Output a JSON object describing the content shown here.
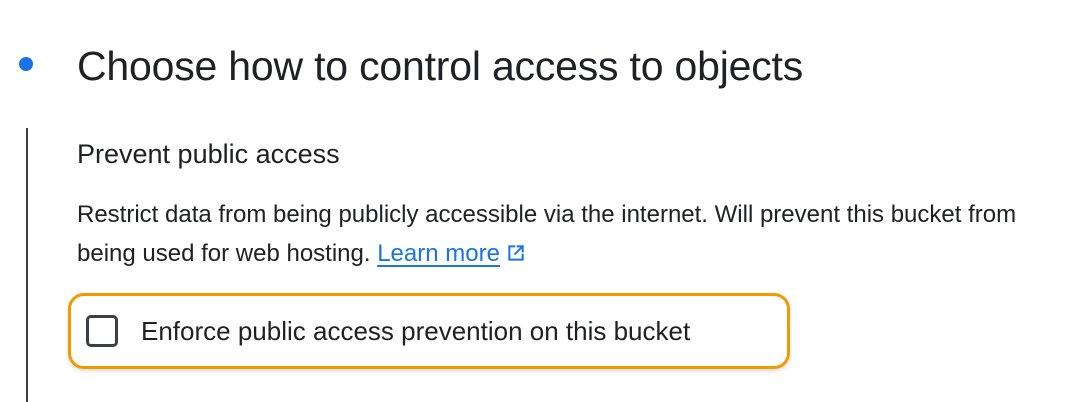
{
  "step": {
    "title": "Choose how to control access to objects",
    "accent_color": "#1a73e8"
  },
  "section": {
    "heading": "Prevent public access",
    "description": "Restrict data from being publicly accessible via the internet. Will prevent this bucket from being used for web hosting.",
    "learn_more_label": "Learn more",
    "learn_more_icon": "external-link-icon",
    "link_color": "#1a73e8"
  },
  "checkbox": {
    "label": "Enforce public access prevention on this bucket",
    "checked": false,
    "highlight_color": "#f29900"
  }
}
